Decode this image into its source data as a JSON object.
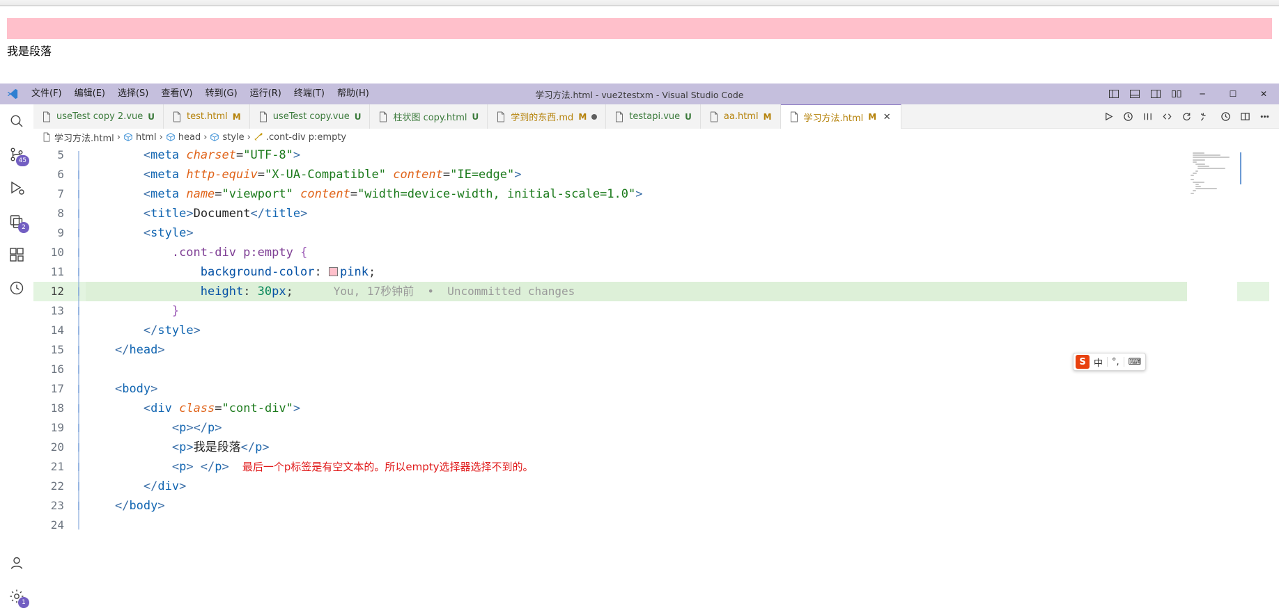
{
  "preview": {
    "paragraph_text": "我是段落",
    "pink_bar_color": "#ffc0cb"
  },
  "titlebar": {
    "title": "学习方法.html - vue2testxm - Visual Studio Code",
    "menu": [
      {
        "label": "文件(F)"
      },
      {
        "label": "编辑(E)"
      },
      {
        "label": "选择(S)"
      },
      {
        "label": "查看(V)"
      },
      {
        "label": "转到(G)"
      },
      {
        "label": "运行(R)"
      },
      {
        "label": "终端(T)"
      },
      {
        "label": "帮助(H)"
      }
    ],
    "window_controls": {
      "minimize": "─",
      "maximize": "☐",
      "close": "✕"
    }
  },
  "activitybar": {
    "items": [
      {
        "name": "search",
        "badge": ""
      },
      {
        "name": "source-control",
        "badge": "45"
      },
      {
        "name": "run-and-debug",
        "badge": ""
      },
      {
        "name": "remote-explorer",
        "badge": "2"
      },
      {
        "name": "extensions",
        "badge": ""
      },
      {
        "name": "timeline",
        "badge": ""
      },
      {
        "name": "accounts",
        "badge": ""
      },
      {
        "name": "manage-settings",
        "badge": "1"
      }
    ]
  },
  "tabs": [
    {
      "label": "useTest copy 2.vue",
      "badge": "U",
      "badge_kind": "u",
      "color": "green",
      "active": false,
      "dirty": false
    },
    {
      "label": "test.html",
      "badge": "M",
      "badge_kind": "m",
      "color": "orange",
      "active": false,
      "dirty": false
    },
    {
      "label": "useTest copy.vue",
      "badge": "U",
      "badge_kind": "u",
      "color": "green",
      "active": false,
      "dirty": false
    },
    {
      "label": "柱状图 copy.html",
      "badge": "U",
      "badge_kind": "u",
      "color": "green",
      "active": false,
      "dirty": false
    },
    {
      "label": "学到的东西.md",
      "badge": "M",
      "badge_kind": "m",
      "color": "orange",
      "active": false,
      "dirty": true
    },
    {
      "label": "testapi.vue",
      "badge": "U",
      "badge_kind": "u",
      "color": "green",
      "active": false,
      "dirty": false
    },
    {
      "label": "aa.html",
      "badge": "M",
      "badge_kind": "m",
      "color": "orange",
      "active": false,
      "dirty": false
    },
    {
      "label": "学习方法.html",
      "badge": "M",
      "badge_kind": "m",
      "color": "orange",
      "active": true,
      "dirty": false
    }
  ],
  "tab_close_glyph": "✕",
  "breadcrumbs": [
    {
      "label": "学习方法.html",
      "icon": "file-icon"
    },
    {
      "label": "html",
      "icon": "symbol-cube-icon"
    },
    {
      "label": "head",
      "icon": "symbol-cube-icon"
    },
    {
      "label": "style",
      "icon": "symbol-cube-icon"
    },
    {
      "label": ".cont-div p:empty",
      "icon": "symbol-ruler-icon"
    }
  ],
  "breadcrumb_separator": "›",
  "editor": {
    "highlighted_line": 12,
    "blame": "You, 17秒钟前  •  Uncommitted changes",
    "color_swatch": "#ffc0cb",
    "lines": [
      {
        "n": "5",
        "segments": [
          {
            "t": "punc",
            "v": "        "
          },
          {
            "t": "br",
            "v": "<"
          },
          {
            "t": "tag",
            "v": "meta"
          },
          {
            "t": "punc",
            "v": " "
          },
          {
            "t": "attr",
            "v": "charset"
          },
          {
            "t": "punc",
            "v": "="
          },
          {
            "t": "str",
            "v": "\"UTF-8\""
          },
          {
            "t": "br",
            "v": ">"
          }
        ]
      },
      {
        "n": "6",
        "segments": [
          {
            "t": "punc",
            "v": "        "
          },
          {
            "t": "br",
            "v": "<"
          },
          {
            "t": "tag",
            "v": "meta"
          },
          {
            "t": "punc",
            "v": " "
          },
          {
            "t": "attr",
            "v": "http-equiv"
          },
          {
            "t": "punc",
            "v": "="
          },
          {
            "t": "str",
            "v": "\"X-UA-Compatible\""
          },
          {
            "t": "punc",
            "v": " "
          },
          {
            "t": "attr",
            "v": "content"
          },
          {
            "t": "punc",
            "v": "="
          },
          {
            "t": "str",
            "v": "\"IE=edge\""
          },
          {
            "t": "br",
            "v": ">"
          }
        ]
      },
      {
        "n": "7",
        "segments": [
          {
            "t": "punc",
            "v": "        "
          },
          {
            "t": "br",
            "v": "<"
          },
          {
            "t": "tag",
            "v": "meta"
          },
          {
            "t": "punc",
            "v": " "
          },
          {
            "t": "attr",
            "v": "name"
          },
          {
            "t": "punc",
            "v": "="
          },
          {
            "t": "str",
            "v": "\"viewport\""
          },
          {
            "t": "punc",
            "v": " "
          },
          {
            "t": "attr",
            "v": "content"
          },
          {
            "t": "punc",
            "v": "="
          },
          {
            "t": "str",
            "v": "\"width=device-width, initial-scale=1.0\""
          },
          {
            "t": "br",
            "v": ">"
          }
        ]
      },
      {
        "n": "8",
        "segments": [
          {
            "t": "punc",
            "v": "        "
          },
          {
            "t": "br",
            "v": "<"
          },
          {
            "t": "tag",
            "v": "title"
          },
          {
            "t": "br",
            "v": ">"
          },
          {
            "t": "txt",
            "v": "Document"
          },
          {
            "t": "br",
            "v": "</"
          },
          {
            "t": "tag",
            "v": "title"
          },
          {
            "t": "br",
            "v": ">"
          }
        ]
      },
      {
        "n": "9",
        "segments": [
          {
            "t": "punc",
            "v": "        "
          },
          {
            "t": "br",
            "v": "<"
          },
          {
            "t": "tag",
            "v": "style"
          },
          {
            "t": "br",
            "v": ">"
          }
        ]
      },
      {
        "n": "10",
        "segments": [
          {
            "t": "punc",
            "v": "            "
          },
          {
            "t": "sel",
            "v": ".cont-div p:empty"
          },
          {
            "t": "punc",
            "v": " "
          },
          {
            "t": "brace-p",
            "v": "{"
          }
        ]
      },
      {
        "n": "11",
        "segments": [
          {
            "t": "punc",
            "v": "                "
          },
          {
            "t": "prop",
            "v": "background-color"
          },
          {
            "t": "punc",
            "v": ": "
          },
          {
            "t": "swatch",
            "v": ""
          },
          {
            "t": "val",
            "v": "pink"
          },
          {
            "t": "punc",
            "v": ";"
          }
        ]
      },
      {
        "n": "12",
        "segments": [
          {
            "t": "punc",
            "v": "                "
          },
          {
            "t": "prop",
            "v": "height"
          },
          {
            "t": "punc",
            "v": ": "
          },
          {
            "t": "num",
            "v": "30"
          },
          {
            "t": "val",
            "v": "px"
          },
          {
            "t": "punc",
            "v": ";"
          },
          {
            "t": "blame",
            "v": "      You, 17秒钟前  •  Uncommitted changes"
          }
        ]
      },
      {
        "n": "13",
        "segments": [
          {
            "t": "punc",
            "v": "            "
          },
          {
            "t": "brace-p",
            "v": "}"
          }
        ]
      },
      {
        "n": "14",
        "segments": [
          {
            "t": "punc",
            "v": "        "
          },
          {
            "t": "br",
            "v": "</"
          },
          {
            "t": "tag",
            "v": "style"
          },
          {
            "t": "br",
            "v": ">"
          }
        ]
      },
      {
        "n": "15",
        "segments": [
          {
            "t": "punc",
            "v": "    "
          },
          {
            "t": "br",
            "v": "</"
          },
          {
            "t": "tag",
            "v": "head"
          },
          {
            "t": "br",
            "v": ">"
          }
        ]
      },
      {
        "n": "16",
        "segments": []
      },
      {
        "n": "17",
        "segments": [
          {
            "t": "punc",
            "v": "    "
          },
          {
            "t": "br",
            "v": "<"
          },
          {
            "t": "tag",
            "v": "body"
          },
          {
            "t": "br",
            "v": ">"
          }
        ]
      },
      {
        "n": "18",
        "segments": [
          {
            "t": "punc",
            "v": "        "
          },
          {
            "t": "br",
            "v": "<"
          },
          {
            "t": "tag",
            "v": "div"
          },
          {
            "t": "punc",
            "v": " "
          },
          {
            "t": "attr",
            "v": "class"
          },
          {
            "t": "punc",
            "v": "="
          },
          {
            "t": "str",
            "v": "\"cont-div\""
          },
          {
            "t": "br",
            "v": ">"
          }
        ]
      },
      {
        "n": "19",
        "segments": [
          {
            "t": "punc",
            "v": "            "
          },
          {
            "t": "br",
            "v": "<"
          },
          {
            "t": "tag",
            "v": "p"
          },
          {
            "t": "br",
            "v": "></"
          },
          {
            "t": "tag",
            "v": "p"
          },
          {
            "t": "br",
            "v": ">"
          }
        ]
      },
      {
        "n": "20",
        "segments": [
          {
            "t": "punc",
            "v": "            "
          },
          {
            "t": "br",
            "v": "<"
          },
          {
            "t": "tag",
            "v": "p"
          },
          {
            "t": "br",
            "v": ">"
          },
          {
            "t": "txt",
            "v": "我是段落"
          },
          {
            "t": "br",
            "v": "</"
          },
          {
            "t": "tag",
            "v": "p"
          },
          {
            "t": "br",
            "v": ">"
          }
        ]
      },
      {
        "n": "21",
        "segments": [
          {
            "t": "punc",
            "v": "            "
          },
          {
            "t": "br",
            "v": "<"
          },
          {
            "t": "tag",
            "v": "p"
          },
          {
            "t": "br",
            "v": "> </"
          },
          {
            "t": "tag",
            "v": "p"
          },
          {
            "t": "br",
            "v": ">"
          },
          {
            "t": "note",
            "v": "    最后一个p标签是有空文本的。所以empty选择器选择不到的。"
          }
        ]
      },
      {
        "n": "22",
        "segments": [
          {
            "t": "punc",
            "v": "        "
          },
          {
            "t": "br",
            "v": "</"
          },
          {
            "t": "tag",
            "v": "div"
          },
          {
            "t": "br",
            "v": ">"
          }
        ]
      },
      {
        "n": "23",
        "segments": [
          {
            "t": "punc",
            "v": "    "
          },
          {
            "t": "br",
            "v": "</"
          },
          {
            "t": "tag",
            "v": "body"
          },
          {
            "t": "br",
            "v": ">"
          }
        ]
      },
      {
        "n": "24",
        "segments": []
      }
    ]
  },
  "ime": {
    "logo": "S",
    "mode": "中",
    "punct": "°,",
    "keyboard": "⌨"
  }
}
